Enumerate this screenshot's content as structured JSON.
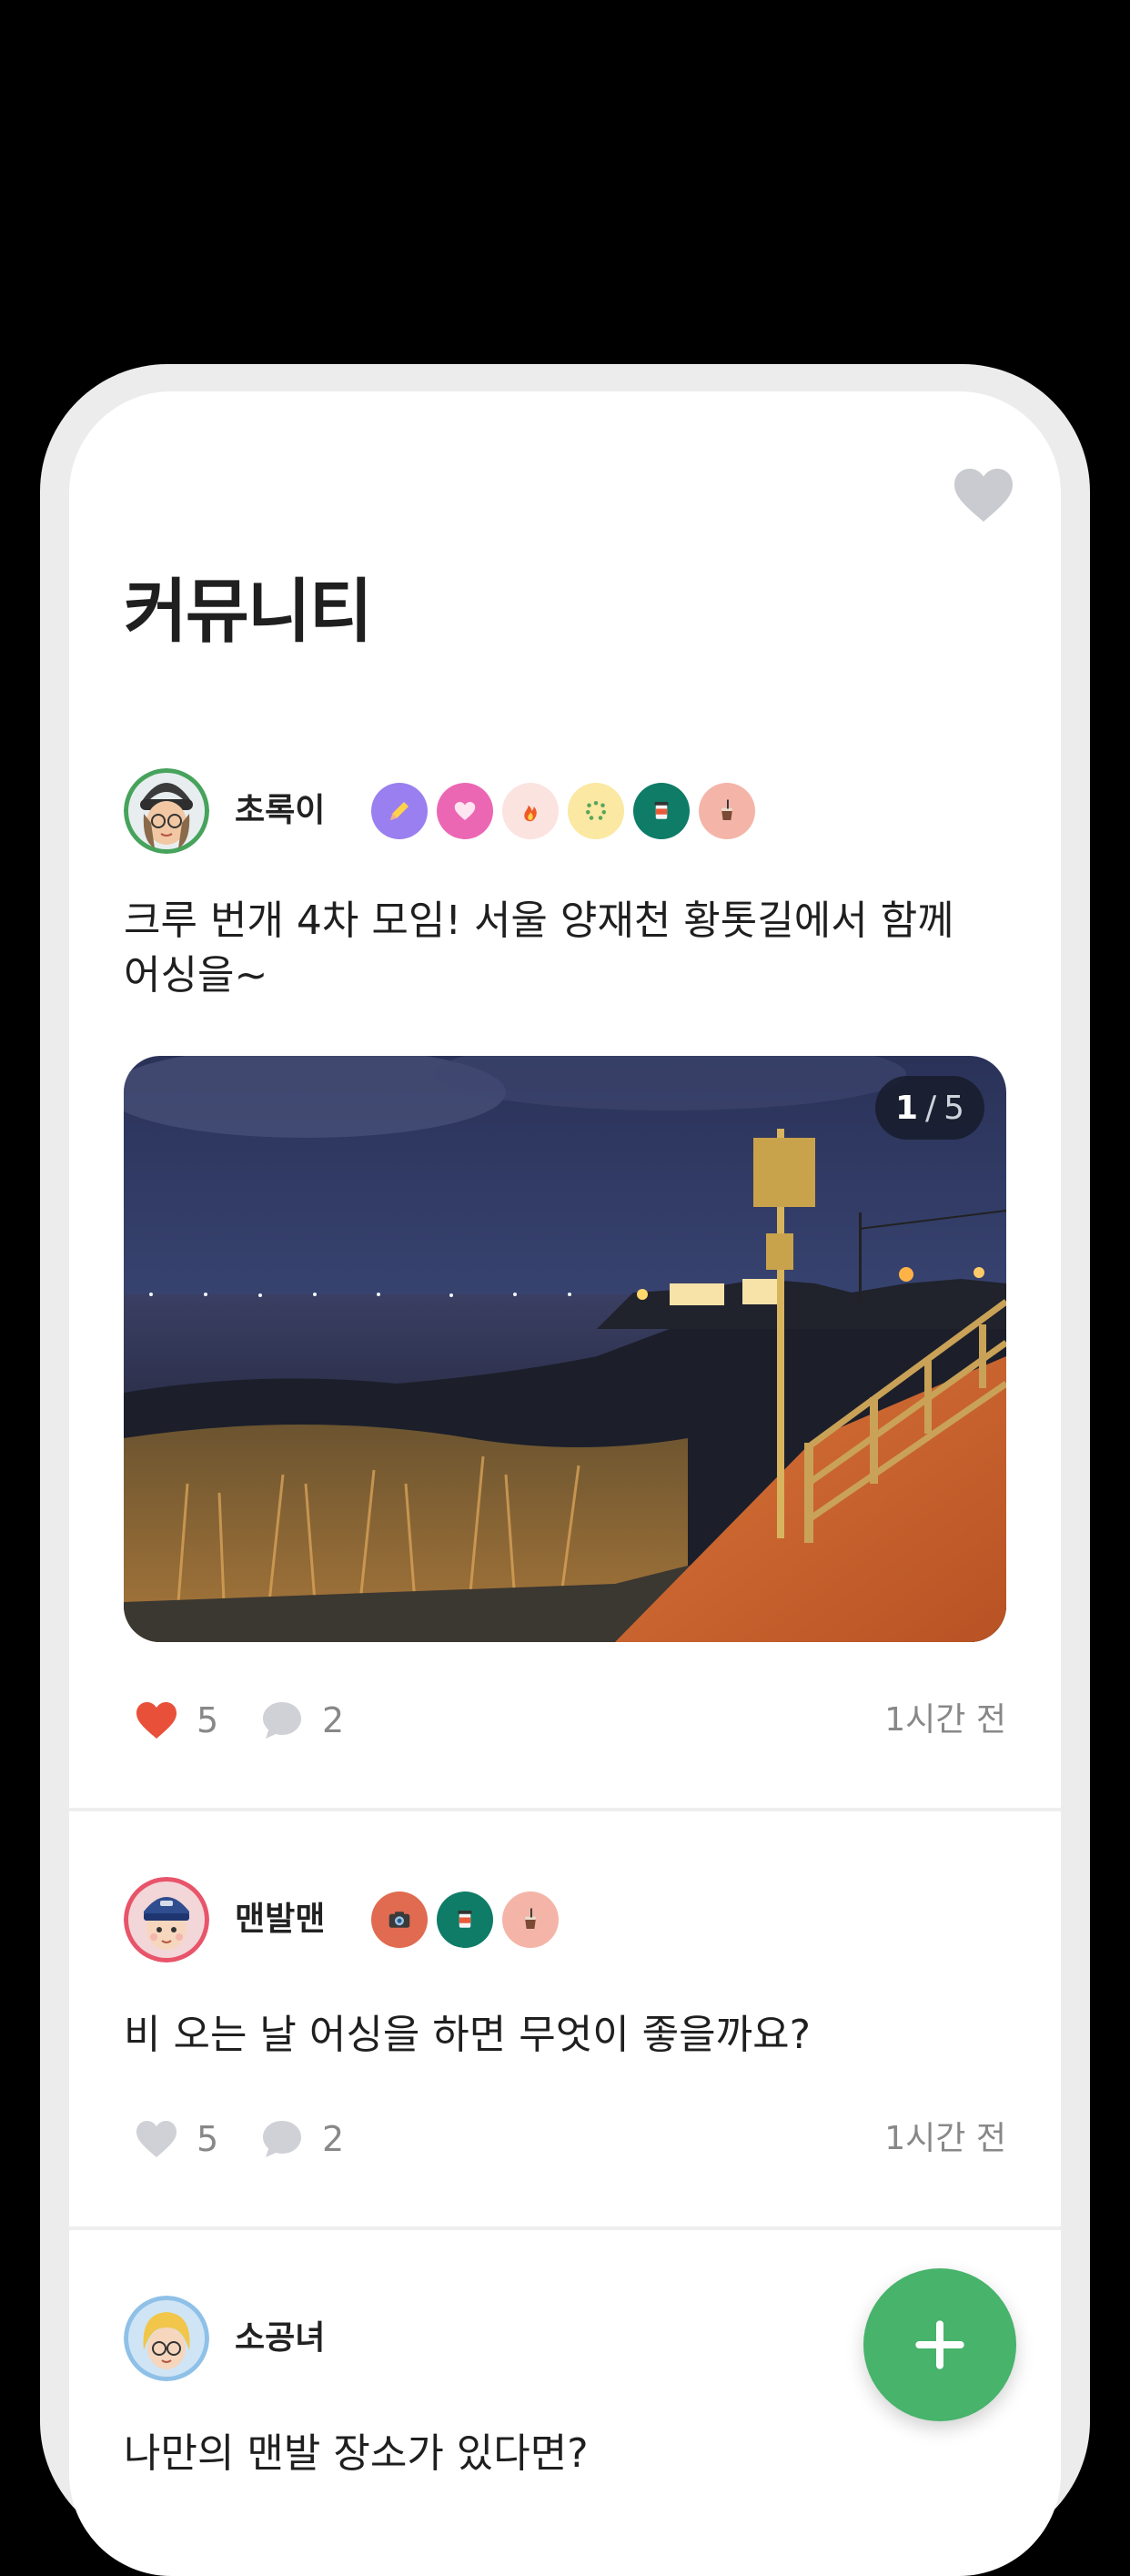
{
  "header": {
    "title": "커뮤니티",
    "favorite_icon": "heart-icon"
  },
  "posts": [
    {
      "author": "초록이",
      "badges": [
        "pencil-badge",
        "heart-badge",
        "fire-badge",
        "dots-badge",
        "cup-badge",
        "drink-badge"
      ],
      "text": "크루 번개 4차 모임! 서울 양재천 황톳길에서 함께 어싱을~",
      "photo": {
        "current": "1",
        "separator": "/",
        "total": "5"
      },
      "likes": "5",
      "liked": true,
      "comments": "2",
      "time": "1시간 전"
    },
    {
      "author": "맨발맨",
      "badges": [
        "camera-badge",
        "cup-badge",
        "drink-badge"
      ],
      "text": "비 오는 날 어싱을 하면 무엇이 좋을까요?",
      "likes": "5",
      "liked": false,
      "comments": "2",
      "time": "1시간 전"
    },
    {
      "author": "소공녀",
      "badges": [],
      "text": "나만의 맨발 장소가 있다면?"
    }
  ],
  "fab": {
    "icon": "plus-icon"
  },
  "colors": {
    "accent": "#47b36b",
    "like": "#e8503a",
    "muted": "#cfd1d6"
  }
}
